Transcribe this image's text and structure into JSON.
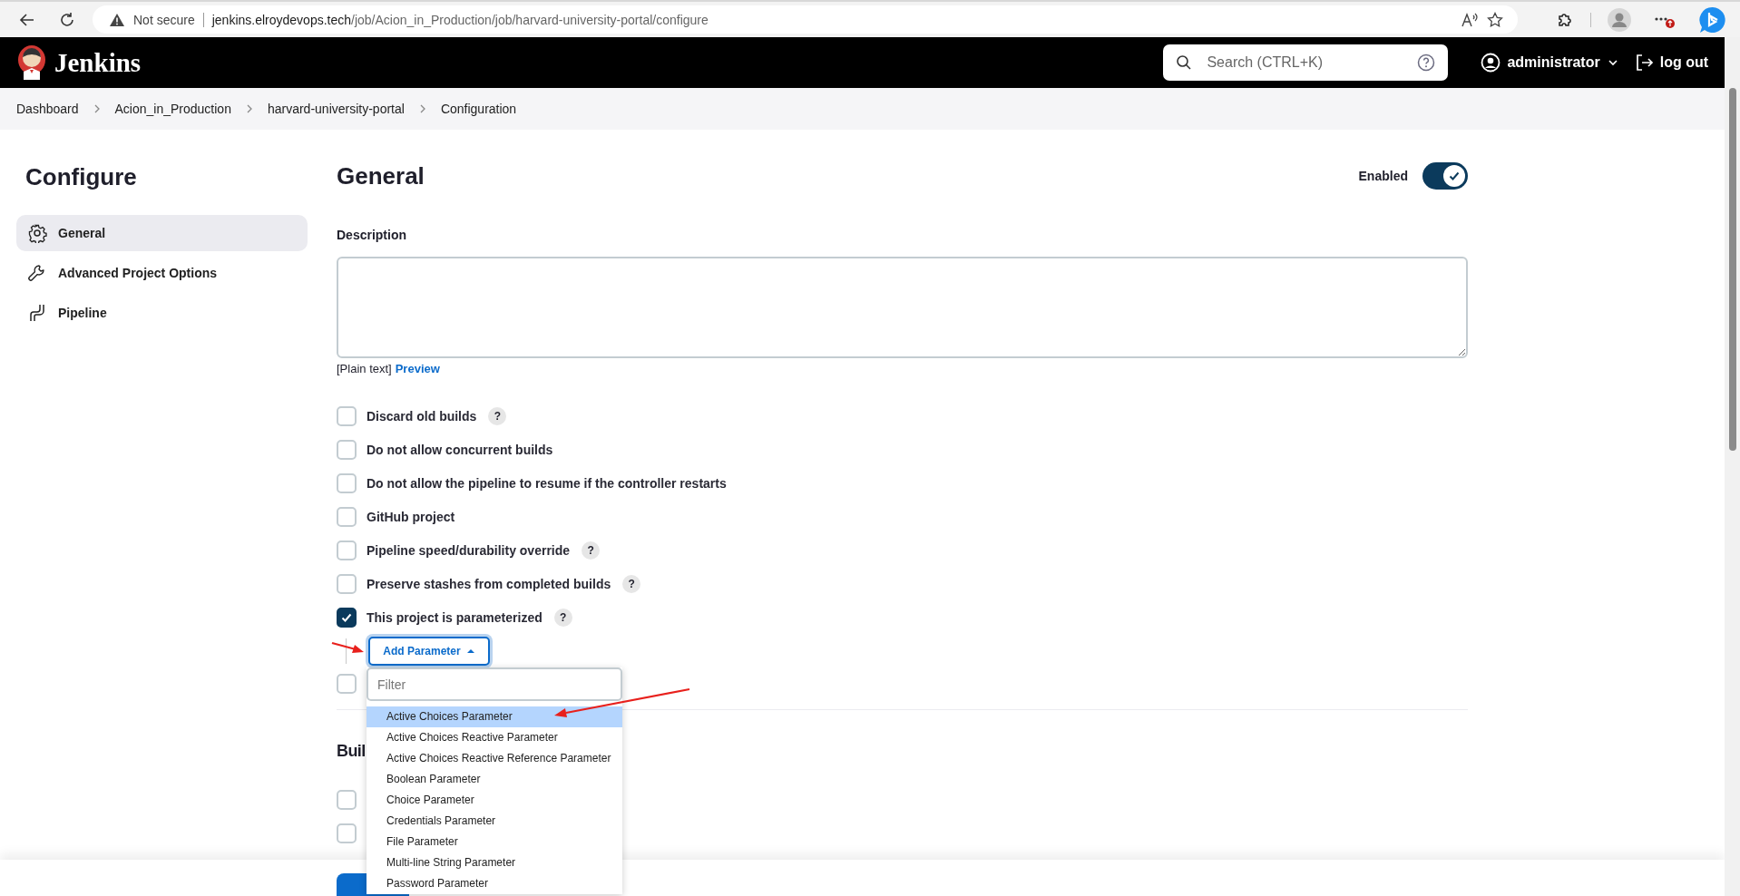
{
  "browser": {
    "security_label": "Not secure",
    "url_host": "jenkins.elroydevops.tech",
    "url_path": "/job/Acion_in_Production/job/harvard-university-portal/configure"
  },
  "header": {
    "brand": "Jenkins",
    "search_placeholder": "Search (CTRL+K)",
    "user": "administrator",
    "logout": "log out"
  },
  "breadcrumbs": [
    "Dashboard",
    "Acion_in_Production",
    "harvard-university-portal",
    "Configuration"
  ],
  "sidebar": {
    "title": "Configure",
    "items": [
      {
        "label": "General",
        "kind": "gear",
        "selected": true
      },
      {
        "label": "Advanced Project Options",
        "kind": "wrench",
        "selected": false
      },
      {
        "label": "Pipeline",
        "kind": "pipeline",
        "selected": false
      }
    ]
  },
  "section": {
    "title": "General",
    "enabled": {
      "label": "Enabled",
      "on": true
    },
    "description_label": "Description",
    "format_note": "[Plain text]",
    "preview_link": "Preview",
    "options": [
      {
        "label": "Discard old builds",
        "checked": false,
        "help": "?"
      },
      {
        "label": "Do not allow concurrent builds",
        "checked": false
      },
      {
        "label": "Do not allow the pipeline to resume if the controller restarts",
        "checked": false
      },
      {
        "label": "GitHub project",
        "checked": false
      },
      {
        "label": "Pipeline speed/durability override",
        "checked": false,
        "help": "?"
      },
      {
        "label": "Preserve stashes from completed builds",
        "checked": false,
        "help": "?"
      },
      {
        "label": "This project is parameterized",
        "checked": true,
        "help": "?"
      }
    ],
    "add_parameter": "Add Parameter",
    "covered_option": {
      "checked": false
    },
    "next_section_title": "Buil",
    "next_options": [
      {
        "checked": false
      },
      {
        "checked": false
      }
    ]
  },
  "dropdown": {
    "filter_placeholder": "Filter",
    "items": [
      {
        "label": "Active Choices Parameter",
        "selected": true
      },
      {
        "label": "Active Choices Reactive Parameter",
        "selected": false
      },
      {
        "label": "Active Choices Reactive Reference Parameter",
        "selected": false
      },
      {
        "label": "Boolean Parameter",
        "selected": false
      },
      {
        "label": "Choice Parameter",
        "selected": false
      },
      {
        "label": "Credentials Parameter",
        "selected": false
      },
      {
        "label": "File Parameter",
        "selected": false
      },
      {
        "label": "Multi-line String Parameter",
        "selected": false
      },
      {
        "label": "Password Parameter",
        "selected": false
      }
    ]
  }
}
